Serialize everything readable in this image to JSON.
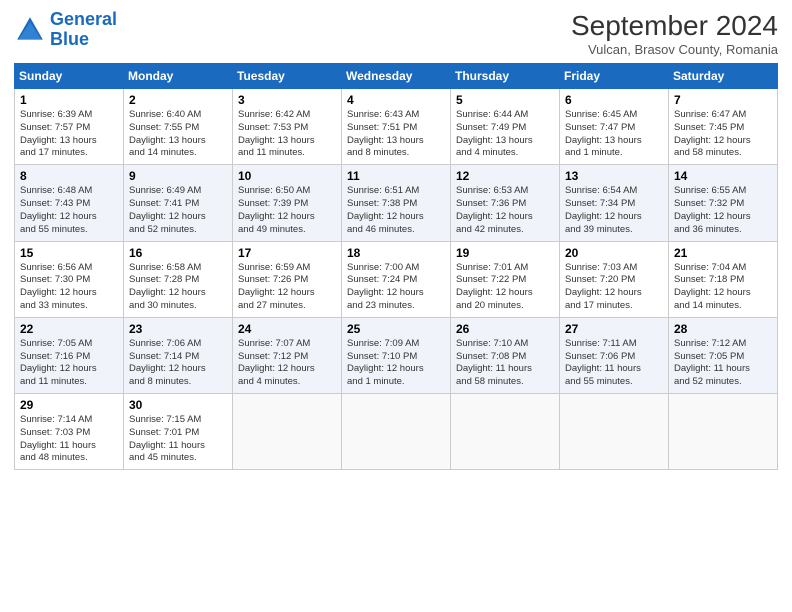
{
  "header": {
    "logo_line1": "General",
    "logo_line2": "Blue",
    "month": "September 2024",
    "location": "Vulcan, Brasov County, Romania"
  },
  "columns": [
    "Sunday",
    "Monday",
    "Tuesday",
    "Wednesday",
    "Thursday",
    "Friday",
    "Saturday"
  ],
  "weeks": [
    [
      {
        "day": "1",
        "info": "Sunrise: 6:39 AM\nSunset: 7:57 PM\nDaylight: 13 hours\nand 17 minutes."
      },
      {
        "day": "2",
        "info": "Sunrise: 6:40 AM\nSunset: 7:55 PM\nDaylight: 13 hours\nand 14 minutes."
      },
      {
        "day": "3",
        "info": "Sunrise: 6:42 AM\nSunset: 7:53 PM\nDaylight: 13 hours\nand 11 minutes."
      },
      {
        "day": "4",
        "info": "Sunrise: 6:43 AM\nSunset: 7:51 PM\nDaylight: 13 hours\nand 8 minutes."
      },
      {
        "day": "5",
        "info": "Sunrise: 6:44 AM\nSunset: 7:49 PM\nDaylight: 13 hours\nand 4 minutes."
      },
      {
        "day": "6",
        "info": "Sunrise: 6:45 AM\nSunset: 7:47 PM\nDaylight: 13 hours\nand 1 minute."
      },
      {
        "day": "7",
        "info": "Sunrise: 6:47 AM\nSunset: 7:45 PM\nDaylight: 12 hours\nand 58 minutes."
      }
    ],
    [
      {
        "day": "8",
        "info": "Sunrise: 6:48 AM\nSunset: 7:43 PM\nDaylight: 12 hours\nand 55 minutes."
      },
      {
        "day": "9",
        "info": "Sunrise: 6:49 AM\nSunset: 7:41 PM\nDaylight: 12 hours\nand 52 minutes."
      },
      {
        "day": "10",
        "info": "Sunrise: 6:50 AM\nSunset: 7:39 PM\nDaylight: 12 hours\nand 49 minutes."
      },
      {
        "day": "11",
        "info": "Sunrise: 6:51 AM\nSunset: 7:38 PM\nDaylight: 12 hours\nand 46 minutes."
      },
      {
        "day": "12",
        "info": "Sunrise: 6:53 AM\nSunset: 7:36 PM\nDaylight: 12 hours\nand 42 minutes."
      },
      {
        "day": "13",
        "info": "Sunrise: 6:54 AM\nSunset: 7:34 PM\nDaylight: 12 hours\nand 39 minutes."
      },
      {
        "day": "14",
        "info": "Sunrise: 6:55 AM\nSunset: 7:32 PM\nDaylight: 12 hours\nand 36 minutes."
      }
    ],
    [
      {
        "day": "15",
        "info": "Sunrise: 6:56 AM\nSunset: 7:30 PM\nDaylight: 12 hours\nand 33 minutes."
      },
      {
        "day": "16",
        "info": "Sunrise: 6:58 AM\nSunset: 7:28 PM\nDaylight: 12 hours\nand 30 minutes."
      },
      {
        "day": "17",
        "info": "Sunrise: 6:59 AM\nSunset: 7:26 PM\nDaylight: 12 hours\nand 27 minutes."
      },
      {
        "day": "18",
        "info": "Sunrise: 7:00 AM\nSunset: 7:24 PM\nDaylight: 12 hours\nand 23 minutes."
      },
      {
        "day": "19",
        "info": "Sunrise: 7:01 AM\nSunset: 7:22 PM\nDaylight: 12 hours\nand 20 minutes."
      },
      {
        "day": "20",
        "info": "Sunrise: 7:03 AM\nSunset: 7:20 PM\nDaylight: 12 hours\nand 17 minutes."
      },
      {
        "day": "21",
        "info": "Sunrise: 7:04 AM\nSunset: 7:18 PM\nDaylight: 12 hours\nand 14 minutes."
      }
    ],
    [
      {
        "day": "22",
        "info": "Sunrise: 7:05 AM\nSunset: 7:16 PM\nDaylight: 12 hours\nand 11 minutes."
      },
      {
        "day": "23",
        "info": "Sunrise: 7:06 AM\nSunset: 7:14 PM\nDaylight: 12 hours\nand 8 minutes."
      },
      {
        "day": "24",
        "info": "Sunrise: 7:07 AM\nSunset: 7:12 PM\nDaylight: 12 hours\nand 4 minutes."
      },
      {
        "day": "25",
        "info": "Sunrise: 7:09 AM\nSunset: 7:10 PM\nDaylight: 12 hours\nand 1 minute."
      },
      {
        "day": "26",
        "info": "Sunrise: 7:10 AM\nSunset: 7:08 PM\nDaylight: 11 hours\nand 58 minutes."
      },
      {
        "day": "27",
        "info": "Sunrise: 7:11 AM\nSunset: 7:06 PM\nDaylight: 11 hours\nand 55 minutes."
      },
      {
        "day": "28",
        "info": "Sunrise: 7:12 AM\nSunset: 7:05 PM\nDaylight: 11 hours\nand 52 minutes."
      }
    ],
    [
      {
        "day": "29",
        "info": "Sunrise: 7:14 AM\nSunset: 7:03 PM\nDaylight: 11 hours\nand 48 minutes."
      },
      {
        "day": "30",
        "info": "Sunrise: 7:15 AM\nSunset: 7:01 PM\nDaylight: 11 hours\nand 45 minutes."
      },
      {
        "day": "",
        "info": ""
      },
      {
        "day": "",
        "info": ""
      },
      {
        "day": "",
        "info": ""
      },
      {
        "day": "",
        "info": ""
      },
      {
        "day": "",
        "info": ""
      }
    ]
  ]
}
